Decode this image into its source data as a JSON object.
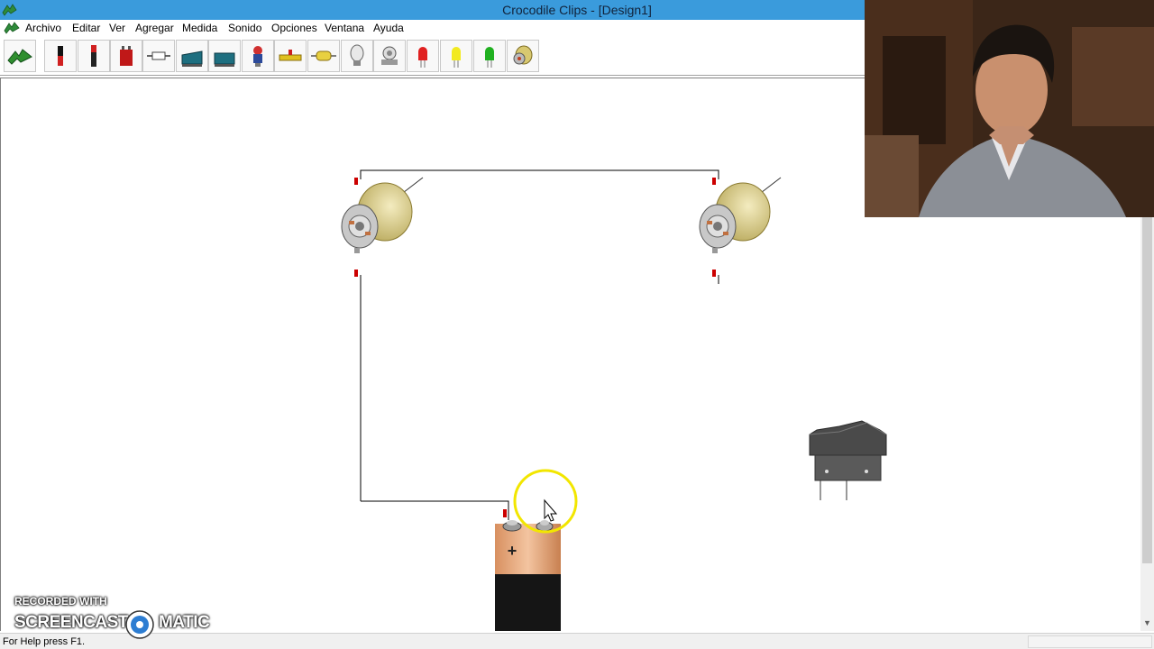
{
  "window": {
    "title": "Crocodile Clips - [Design1]"
  },
  "menu": {
    "items": [
      "Archivo",
      "Editar",
      "Ver",
      "Agregar",
      "Medida",
      "Sonido",
      "Opciones",
      "Ventana",
      "Ayuda"
    ]
  },
  "toolbar": {
    "tools": [
      {
        "icon": "crocodile-clip-icon",
        "color": "#2f8f2f"
      },
      {
        "icon": "battery-cell-icon",
        "color": "#d02020"
      },
      {
        "icon": "battery-cell-tall-icon",
        "color": "#d02020"
      },
      {
        "icon": "battery-9v-icon",
        "color": "#c01818"
      },
      {
        "icon": "fuse-icon",
        "color": "#707070"
      },
      {
        "icon": "switch-icon",
        "color": "#1e6f80"
      },
      {
        "icon": "switch-2-icon",
        "color": "#1e6f80"
      },
      {
        "icon": "push-button-icon",
        "color": "#d03030"
      },
      {
        "icon": "resistor-variable-icon",
        "color": "#e0c020"
      },
      {
        "icon": "resistor-icon",
        "color": "#e8d040"
      },
      {
        "icon": "bulb-icon",
        "color": "#b0b0b0"
      },
      {
        "icon": "buzzer-icon",
        "color": "#909090"
      },
      {
        "icon": "led-red-icon",
        "color": "#e02020"
      },
      {
        "icon": "led-yellow-icon",
        "color": "#f2ea20"
      },
      {
        "icon": "led-green-icon",
        "color": "#20b020"
      },
      {
        "icon": "motor-icon",
        "color": "#d8c870"
      }
    ]
  },
  "canvas": {
    "battery_symbol": "+"
  },
  "status": {
    "text": "For Help press F1."
  },
  "watermark": {
    "line1": "RECORDED WITH",
    "brand_left": "SCREENCAST",
    "brand_right": "MATIC"
  },
  "colors": {
    "titlebar": "#3a9bdc",
    "wire": "#000000",
    "terminal": "#cc0000",
    "cursor_highlight": "#f2e600"
  }
}
